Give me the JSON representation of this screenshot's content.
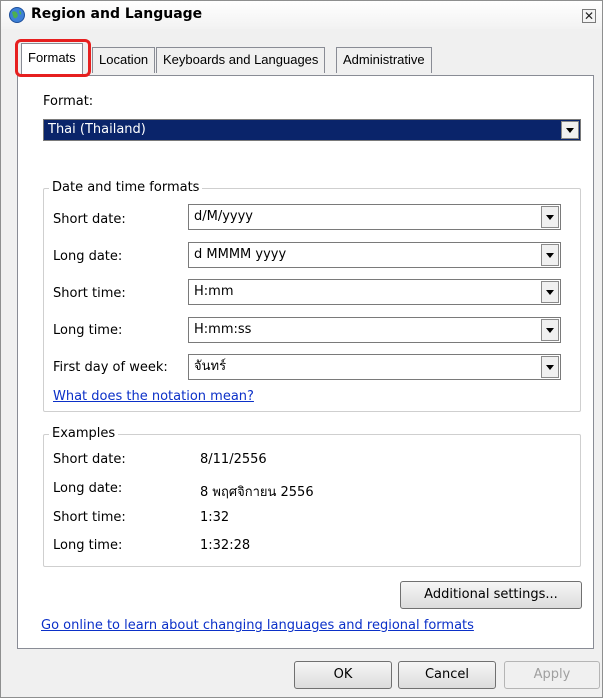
{
  "window": {
    "title": "Region and Language",
    "close_glyph": "✕"
  },
  "tabs": [
    {
      "label": "Formats",
      "active": true
    },
    {
      "label": "Location",
      "active": false
    },
    {
      "label": "Keyboards and Languages",
      "active": false
    },
    {
      "label": "Administrative",
      "active": false
    }
  ],
  "formats": {
    "format_label": "Format:",
    "format_value": "Thai (Thailand)",
    "date_time_group_title": "Date and time formats",
    "fields": [
      {
        "label": "Short date:",
        "value": "d/M/yyyy"
      },
      {
        "label": "Long date:",
        "value": "d MMMM yyyy"
      },
      {
        "label": "Short time:",
        "value": "H:mm"
      },
      {
        "label": "Long time:",
        "value": "H:mm:ss"
      },
      {
        "label": "First day of week:",
        "value": "จันทร์"
      }
    ],
    "notation_link": "What does the notation mean?",
    "examples_group_title": "Examples",
    "examples": [
      {
        "label": "Short date:",
        "value": "8/11/2556"
      },
      {
        "label": "Long date:",
        "value": "8 พฤศจิกายน 2556"
      },
      {
        "label": "Short time:",
        "value": "1:32"
      },
      {
        "label": "Long time:",
        "value": "1:32:28"
      }
    ],
    "additional_settings": "Additional settings...",
    "online_link": "Go online to learn about changing languages and regional formats"
  },
  "buttons": {
    "ok": "OK",
    "cancel": "Cancel",
    "apply": "Apply"
  },
  "colors": {
    "selected_bg": "#0a246a",
    "link": "#0b30c8",
    "highlight": "#e61f1f"
  }
}
